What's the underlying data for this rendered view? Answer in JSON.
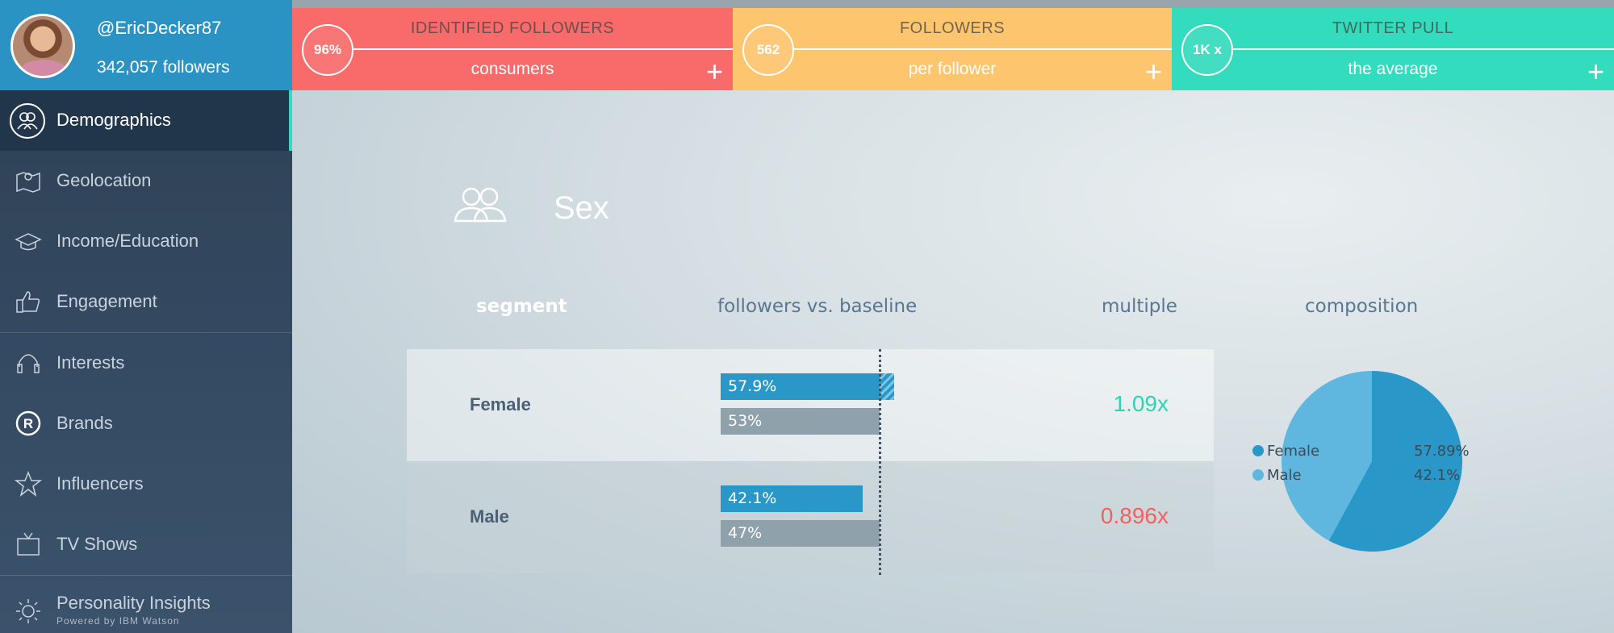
{
  "profile": {
    "handle": "@EricDecker87",
    "followers": "342,057 followers"
  },
  "stats": [
    {
      "circle": "96%",
      "title": "IDENTIFIED FOLLOWERS",
      "sub": "consumers",
      "color": "#f86b6a"
    },
    {
      "circle": "562",
      "title": "FOLLOWERS",
      "sub": "per follower",
      "color": "#fdc56e"
    },
    {
      "circle": "1K x",
      "title": "TWITTER PULL",
      "sub": "the average",
      "color": "#33dcbd"
    }
  ],
  "sidebar": {
    "active": "Demographics",
    "items": [
      {
        "label": "Geolocation",
        "icon": "map-pin-icon"
      },
      {
        "label": "Income/Education",
        "icon": "graduation-cap-icon"
      },
      {
        "label": "Engagement",
        "icon": "thumbs-up-icon"
      },
      {
        "label": "Interests",
        "icon": "headphones-icon"
      },
      {
        "label": "Brands",
        "icon": "registered-icon"
      },
      {
        "label": "Influencers",
        "icon": "star-icon"
      },
      {
        "label": "TV Shows",
        "icon": "tv-icon"
      },
      {
        "label": "Personality Insights",
        "icon": "ibm-watson-icon"
      }
    ],
    "powered_by": "Powered by IBM Watson"
  },
  "section": {
    "title": "Sex",
    "headers": {
      "segment": "segment",
      "baseline": "followers vs. baseline",
      "multiple": "multiple",
      "composition": "composition"
    }
  },
  "chart_data": [
    {
      "type": "bar",
      "categories": [
        "Female",
        "Male"
      ],
      "series": [
        {
          "values": [
            57.9,
            42.1
          ],
          "labels": [
            "57.9%",
            "42.1%"
          ],
          "color": "#2a97c9"
        },
        {
          "values": [
            53,
            47
          ],
          "labels": [
            "53%",
            "47%"
          ],
          "color": "#8fa1aa"
        }
      ],
      "multiples": [
        "1.09x",
        "0.896x"
      ],
      "multiple_colors": [
        "#2ed4b1",
        "#f2605f"
      ],
      "ylim": [
        0,
        100
      ]
    },
    {
      "type": "pie",
      "labels": [
        "Female",
        "Male"
      ],
      "values": [
        57.89,
        42.1
      ],
      "value_labels": [
        "57.89%",
        "42.1%"
      ],
      "colors": [
        "#2a97c9",
        "#5fb7e0"
      ]
    }
  ]
}
